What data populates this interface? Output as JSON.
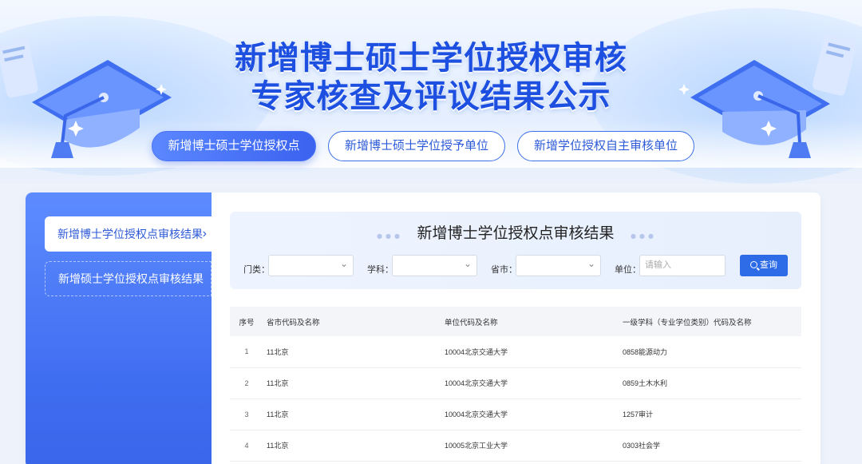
{
  "hero": {
    "title_line1": "新增博士硕士学位授权审核",
    "title_line2": "专家核查及评议结果公示"
  },
  "tabs": [
    {
      "label": "新增博士硕士学位授权点",
      "active": true
    },
    {
      "label": "新增博士硕士学位授予单位",
      "active": false
    },
    {
      "label": "新增学位授权自主审核单位",
      "active": false
    }
  ],
  "sidebar": {
    "items": [
      {
        "label": "新增博士学位授权点审核结果",
        "active": true
      },
      {
        "label": "新增硕士学位授权点审核结果",
        "active": false
      }
    ]
  },
  "filters": {
    "title": "新增博士学位授权点审核结果",
    "category_label": "门类：",
    "subject_label": "学科：",
    "province_label": "省市：",
    "unit_label": "单位：",
    "unit_placeholder": "请输入",
    "query_label": "查询"
  },
  "table": {
    "headers": [
      "序号",
      "省市代码及名称",
      "单位代码及名称",
      "一级学科（专业学位类别）代码及名称"
    ],
    "rows": [
      [
        "1",
        "11北京",
        "10004北京交通大学",
        "0858能源动力"
      ],
      [
        "2",
        "11北京",
        "10004北京交通大学",
        "0859土木水利"
      ],
      [
        "3",
        "11北京",
        "10004北京交通大学",
        "1257审计"
      ],
      [
        "4",
        "11北京",
        "10005北京工业大学",
        "0303社会学"
      ]
    ]
  },
  "colors": {
    "accent": "#3a62f0",
    "title": "#1d4fe0",
    "query_button": "#2e6be6"
  },
  "icons": {
    "left_decoration": "graduation-cap-icon",
    "right_decoration": "graduation-cap-icon",
    "query": "search-icon",
    "sidebar_active": "chevron-right-icon",
    "select": "chevron-down-icon"
  }
}
